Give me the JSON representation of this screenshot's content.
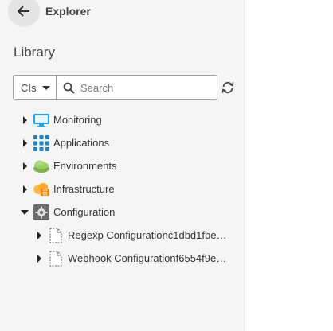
{
  "header": {
    "title": "Explorer",
    "back_icon": "arrow-left-icon"
  },
  "library": {
    "title": "Library"
  },
  "toolbar": {
    "type_select": {
      "value": "CIs",
      "options": [
        "CIs"
      ]
    },
    "search": {
      "placeholder": "Search",
      "value": ""
    },
    "refresh_icon": "refresh-icon"
  },
  "tree": {
    "items": [
      {
        "label": "Monitoring",
        "icon": "monitor-icon",
        "expanded": false,
        "level": 0
      },
      {
        "label": "Applications",
        "icon": "applications-grid-icon",
        "expanded": false,
        "level": 0
      },
      {
        "label": "Environments",
        "icon": "environments-icon",
        "expanded": false,
        "level": 0
      },
      {
        "label": "Infrastructure",
        "icon": "infrastructure-icon",
        "expanded": false,
        "level": 0
      },
      {
        "label": "Configuration",
        "icon": "gear-icon",
        "expanded": true,
        "level": 0
      },
      {
        "label": "Regexp Configurationc1dbd1fbe2...",
        "icon": "file-icon",
        "expanded": false,
        "level": 1
      },
      {
        "label": "Webhook Configurationf6554f9e7...",
        "icon": "file-icon",
        "expanded": false,
        "level": 1
      }
    ]
  },
  "colors": {
    "panel_bg": "#f5f5f5",
    "monitor_blue": "#1aa3e8",
    "apps_blue": "#1b86c9",
    "env_green": "#8bc34a",
    "infra_orange": "#f5a623",
    "gear_gray": "#6d6d6d"
  }
}
